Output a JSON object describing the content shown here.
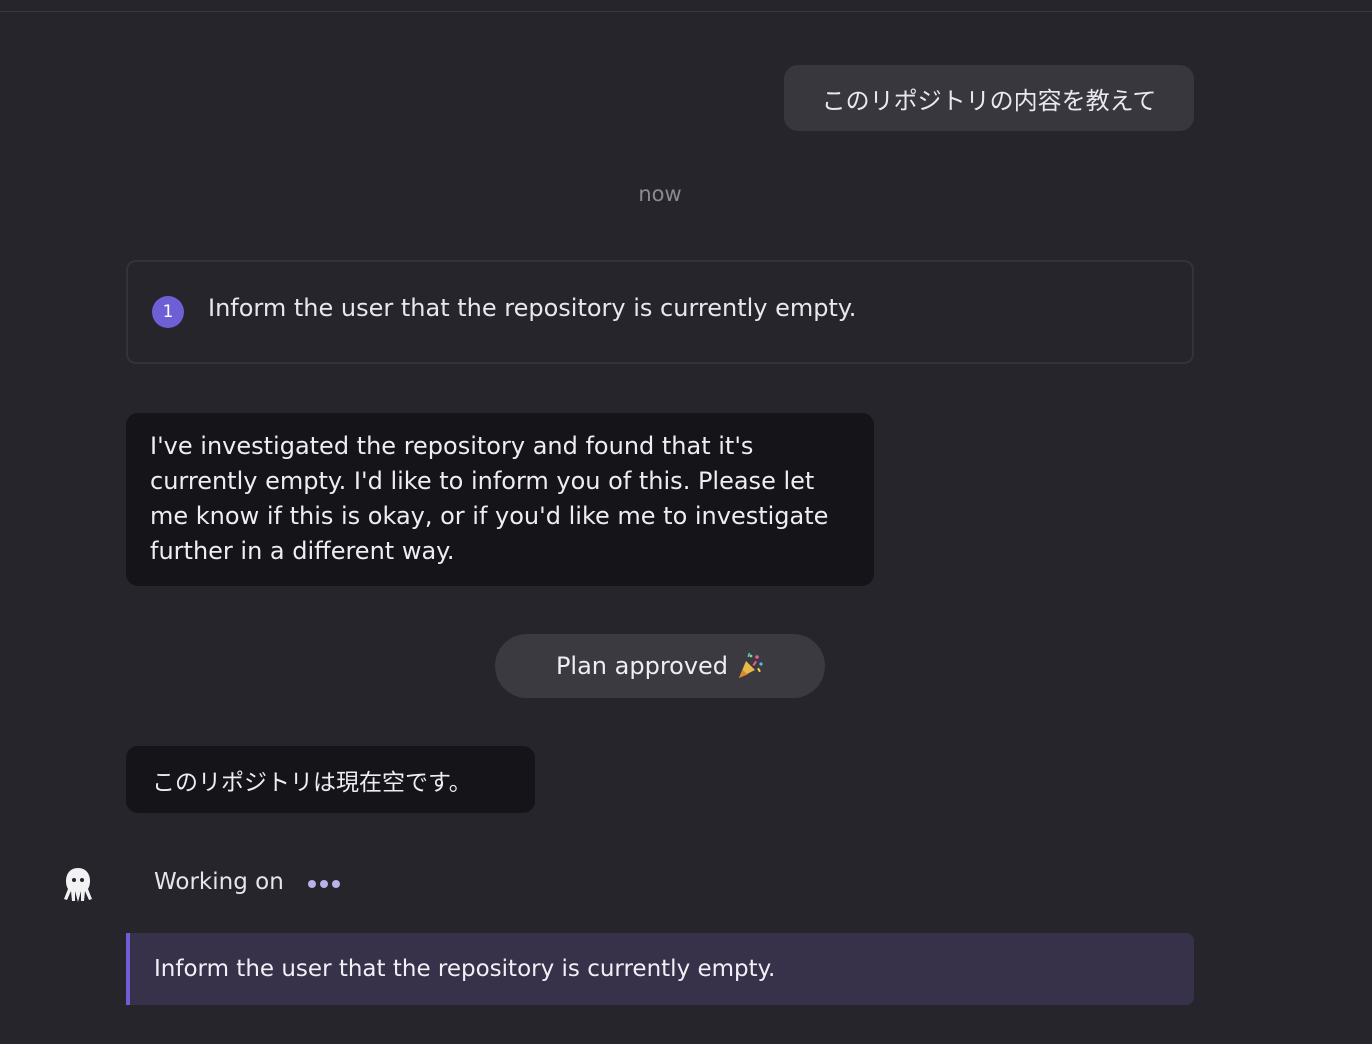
{
  "conversation": {
    "user_message": "このリポジトリの内容を教えて",
    "timestamp": "now",
    "plan": {
      "step_number": "1",
      "step_text": "Inform the user that the repository is currently empty."
    },
    "agent_message": "I've investigated the repository and found that it's currently empty. I'd like to inform you of this. Please let me know if this is okay, or if you'd like me to investigate further in a different way.",
    "approved_label": "Plan approved",
    "agent_reply": "このリポジトリは現在空です。",
    "status": {
      "label": "Working on",
      "current_step": "Inform the user that the repository is currently empty."
    }
  },
  "icons": {
    "agent_avatar": "octopus-icon",
    "celebration": "party-popper-icon",
    "progress": "ellipsis-icon"
  },
  "colors": {
    "accent": "#6f5fd6",
    "background": "#26252b",
    "agent_bubble": "#151419",
    "user_bubble": "#38373e"
  }
}
